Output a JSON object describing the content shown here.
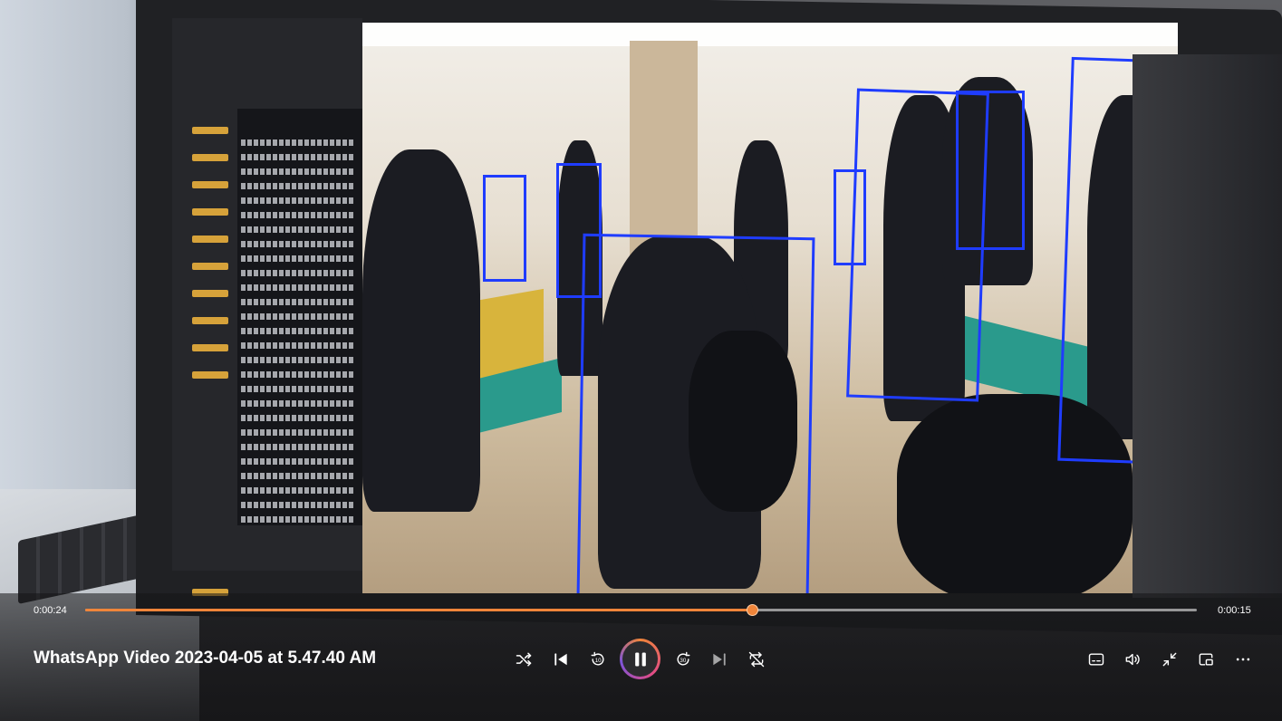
{
  "player": {
    "title": "WhatsApp Video 2023-04-05 at 5.47.40 AM",
    "current_time": "0:00:24",
    "total_time": "0:00:15",
    "progress_fraction": 0.6,
    "accent_color": "#f0853a"
  },
  "controls": {
    "shuffle": "shuffle-icon",
    "previous": "skip-previous-icon",
    "rewind": "rewind-10-icon",
    "rewind_label": "10",
    "play_pause": "pause-icon",
    "forward": "forward-30-icon",
    "forward_label": "30",
    "next": "skip-next-icon",
    "repeat": "repeat-off-icon",
    "captions": "captions-icon",
    "volume": "volume-icon",
    "exit_fullscreen": "exit-fullscreen-icon",
    "miniplayer": "miniplayer-icon",
    "more": "more-options-icon"
  }
}
